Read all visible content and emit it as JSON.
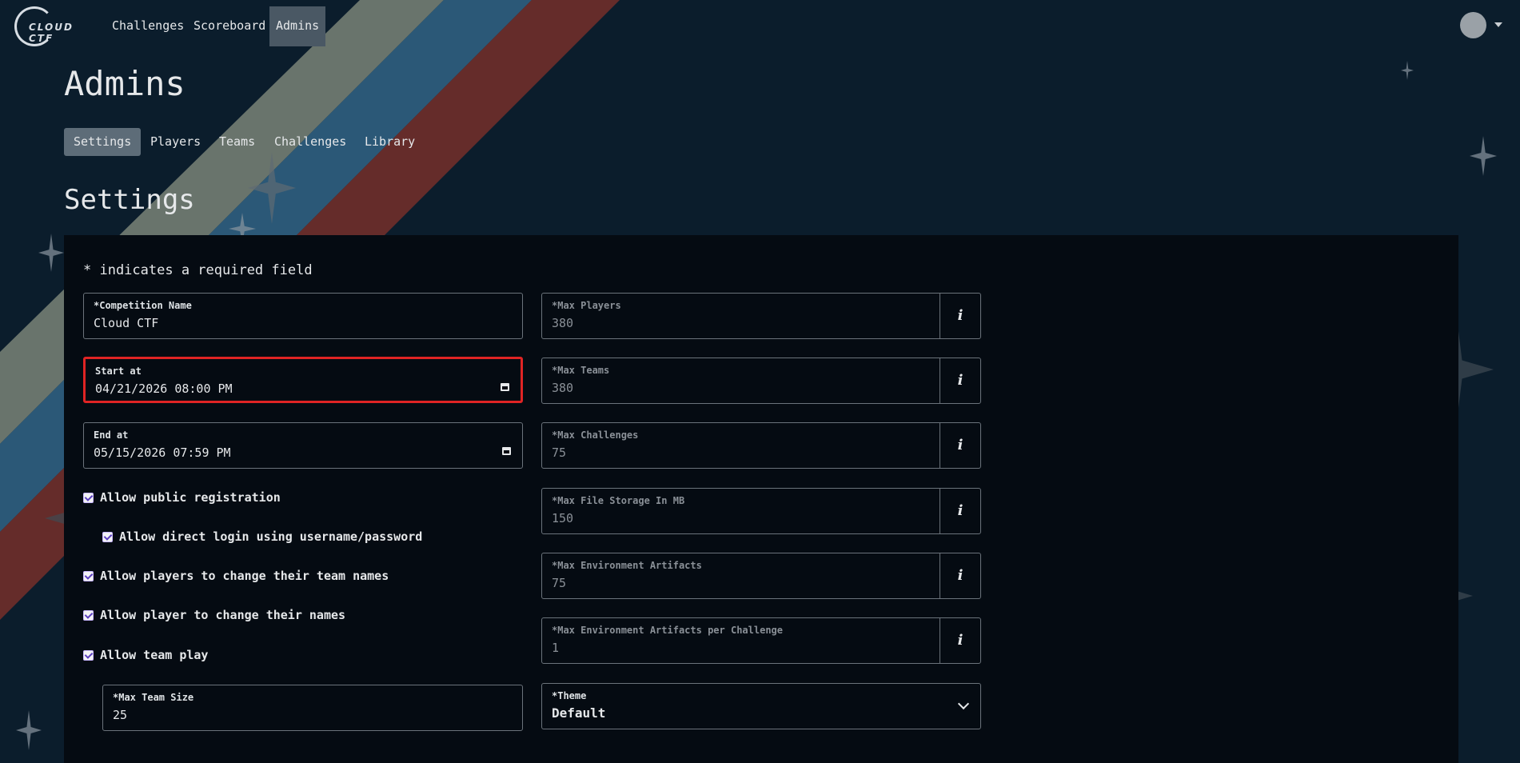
{
  "nav": {
    "logo_text": "CLOUD CTF",
    "links": [
      "Challenges",
      "Scoreboard",
      "Admins"
    ],
    "active": "Admins"
  },
  "page": {
    "title": "Admins"
  },
  "subnav": {
    "items": [
      "Settings",
      "Players",
      "Teams",
      "Challenges",
      "Library"
    ],
    "active": "Settings"
  },
  "section": {
    "title": "Settings"
  },
  "form": {
    "required_note": "* indicates a required field",
    "competition_name": {
      "label": "Competition Name",
      "value": "Cloud CTF"
    },
    "start_at": {
      "label": "Start at",
      "value": "04/21/2026 08:00 PM"
    },
    "end_at": {
      "label": "End at",
      "value": "05/15/2026 07:59 PM"
    },
    "checkboxes": [
      "Allow public registration",
      "Allow direct login using username/password",
      "Allow players to change their team names",
      "Allow player to change their names",
      "Allow team play"
    ],
    "max_team_size": {
      "label": "Max Team Size",
      "value": "25"
    },
    "limits": [
      {
        "label": "Max Players",
        "value": "380"
      },
      {
        "label": "Max Teams",
        "value": "380"
      },
      {
        "label": "Max Challenges",
        "value": "75"
      },
      {
        "label": "Max File Storage In MB",
        "value": "150"
      },
      {
        "label": "Max Environment Artifacts",
        "value": "75"
      },
      {
        "label": "Max Environment Artifacts per Challenge",
        "value": "1"
      }
    ],
    "theme": {
      "label": "Theme",
      "value": "Default"
    },
    "required_marker": "*",
    "info_glyph": "i"
  },
  "colors": {
    "background": "#0b1d2c",
    "panel": "#050b12",
    "highlight": "#e02424",
    "accent": "#5b3fbf"
  }
}
